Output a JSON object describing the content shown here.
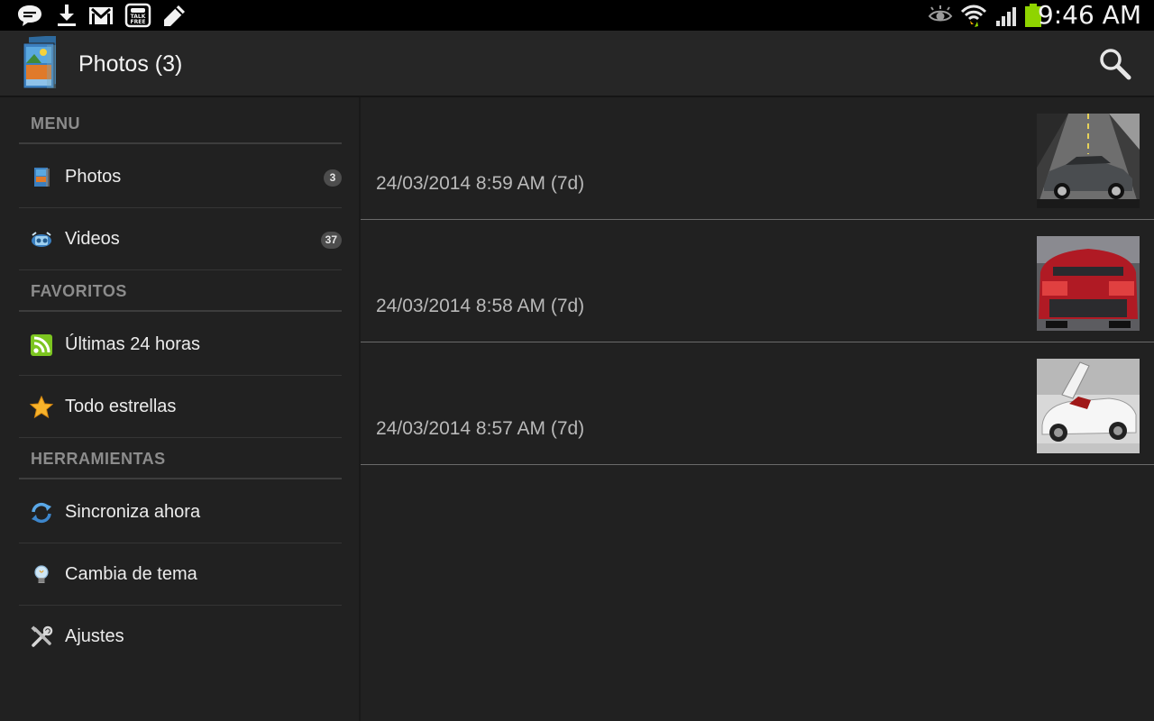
{
  "status_bar": {
    "time": "9:46 AM",
    "left_icons": [
      "chat-bubble-icon",
      "download-icon",
      "gmail-icon",
      "talkfree-icon",
      "pencil-icon"
    ],
    "right_icons": [
      "eye-icon",
      "wifi-icon",
      "signal-icon",
      "battery-icon"
    ],
    "battery_color": "#8fd400"
  },
  "action_bar": {
    "title": "Photos (3)",
    "app_icon": "photos-app-icon",
    "search_icon": "search-icon"
  },
  "sidebar": {
    "sections": [
      {
        "header": "MENU",
        "items": [
          {
            "label": "Photos",
            "badge": "3",
            "icon": "photos-icon"
          },
          {
            "label": "Videos",
            "badge": "37",
            "icon": "videos-icon"
          }
        ]
      },
      {
        "header": "FAVORITOS",
        "items": [
          {
            "label": "Últimas 24 horas",
            "icon": "rss-icon"
          },
          {
            "label": "Todo estrellas",
            "icon": "star-icon"
          }
        ]
      },
      {
        "header": "HERRAMIENTAS",
        "items": [
          {
            "label": "Sincroniza ahora",
            "icon": "sync-icon"
          },
          {
            "label": "Cambia de tema",
            "icon": "lightbulb-icon"
          },
          {
            "label": "Ajustes",
            "icon": "tools-icon"
          }
        ]
      }
    ]
  },
  "photos": [
    {
      "timestamp": "24/03/2014 8:59 AM (7d)",
      "thumbnail": "gray-sedan-on-road"
    },
    {
      "timestamp": "24/03/2014 8:58 AM (7d)",
      "thumbnail": "red-car-rear-view"
    },
    {
      "timestamp": "24/03/2014 8:57 AM (7d)",
      "thumbnail": "white-sports-car"
    }
  ],
  "colors": {
    "background": "#212121",
    "status_bar": "#000000",
    "action_bar": "#262626",
    "section_header_text": "#8c8c8c",
    "timestamp_text": "#b9b9b9"
  }
}
